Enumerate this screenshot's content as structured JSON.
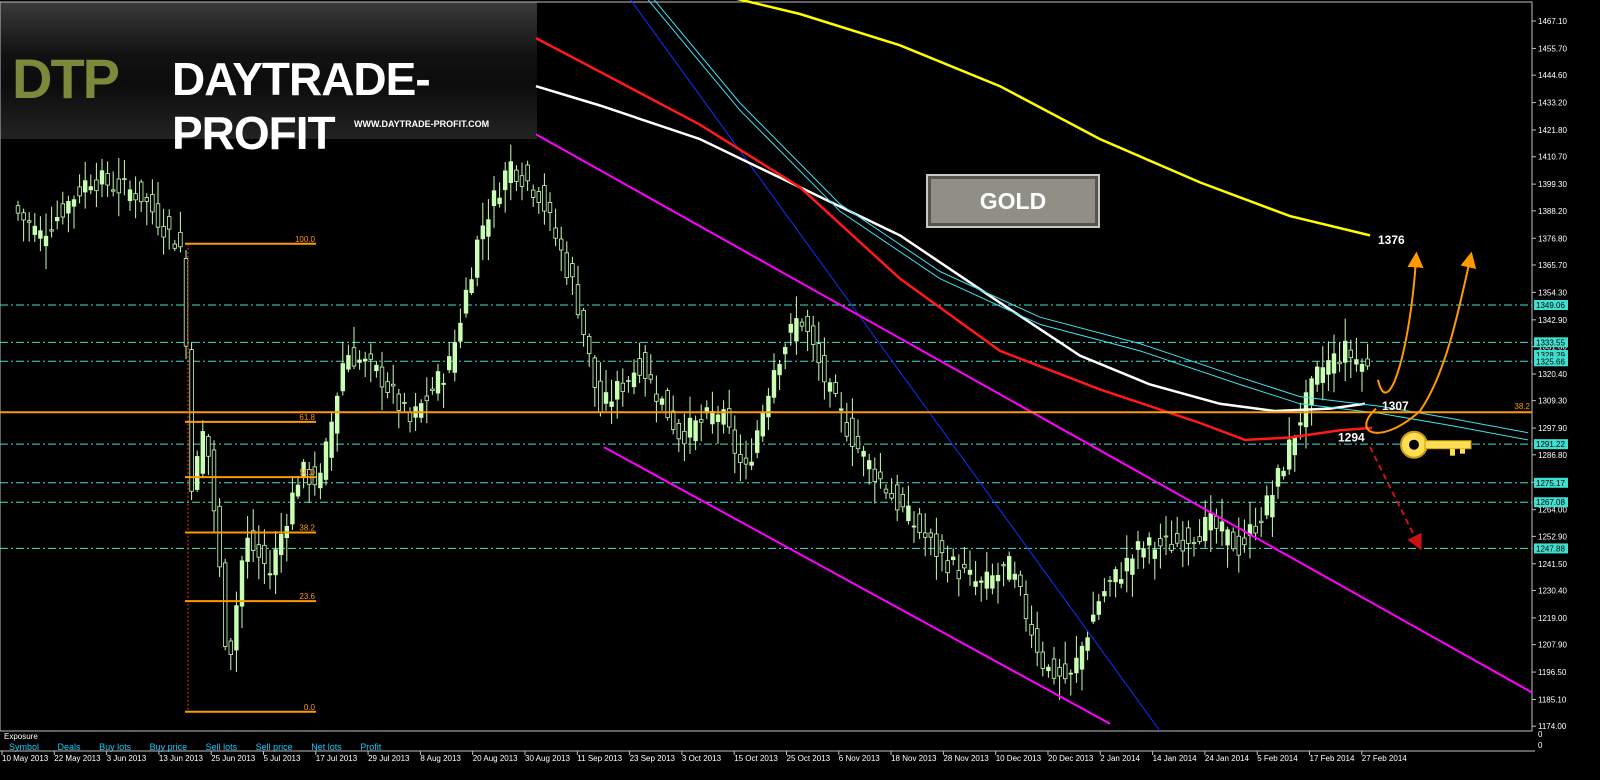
{
  "logo": {
    "mark": "DTP",
    "name": "DAYTRADE-PROFIT",
    "url": "WWW.DAYTRADE-PROFIT.COM"
  },
  "instrument_label": "GOLD",
  "exposure": {
    "title": "Exposure",
    "columns": [
      "Symbol",
      "Deals",
      "Buy lots",
      "Buy price",
      "Sell lots",
      "Sell price",
      "Net lots",
      "Profit"
    ]
  },
  "chart_data": {
    "type": "candlestick",
    "x_labels": [
      "10 May 2013",
      "22 May 2013",
      "3 Jun 2013",
      "13 Jun 2013",
      "25 Jun 2013",
      "5 Jul 2013",
      "17 Jul 2013",
      "29 Jul 2013",
      "8 Aug 2013",
      "20 Aug 2013",
      "30 Aug 2013",
      "11 Sep 2013",
      "23 Sep 2013",
      "3 Oct 2013",
      "15 Oct 2013",
      "25 Oct 2013",
      "6 Nov 2013",
      "18 Nov 2013",
      "28 Nov 2013",
      "10 Dec 2013",
      "20 Dec 2013",
      "2 Jan 2014",
      "14 Jan 2014",
      "24 Jan 2014",
      "5 Feb 2014",
      "17 Feb 2014",
      "27 Feb 2014"
    ],
    "y_ticks": [
      "1467.10",
      "1455.70",
      "1444.60",
      "1433.20",
      "1421.80",
      "1410.70",
      "1399.30",
      "1388.20",
      "1376.80",
      "1365.70",
      "1354.30",
      "1342.90",
      "1331.80",
      "1320.40",
      "1309.30",
      "1297.90",
      "1286.80",
      "1275.40",
      "1264.00",
      "1252.90",
      "1241.50",
      "1230.40",
      "1219.00",
      "1207.90",
      "1196.50",
      "1185.10",
      "1174.00"
    ],
    "y_range": [
      1172,
      1475
    ],
    "price_tags": [
      {
        "label": "1349.06",
        "value": 1349.06
      },
      {
        "label": "1333.55",
        "value": 1333.55
      },
      {
        "label": "1328.29",
        "value": 1328.29
      },
      {
        "label": "1325.66",
        "value": 1325.66
      },
      {
        "label": "1291.22",
        "value": 1291.22
      },
      {
        "label": "1275.17",
        "value": 1275.17
      },
      {
        "label": "1267.08",
        "value": 1267.08
      },
      {
        "label": "1247.88",
        "value": 1247.88
      }
    ],
    "horizontal_levels": [
      1349.06,
      1333.55,
      1325.66,
      1291.22,
      1275.17,
      1267.08,
      1247.88
    ],
    "key_level": {
      "value": 1304.5,
      "label": "38.2"
    },
    "fibonacci": [
      {
        "label": "100.0",
        "value": 1374.5
      },
      {
        "label": "61.8",
        "value": 1300.5
      },
      {
        "label": "50.0",
        "value": 1277.5
      },
      {
        "label": "38.2",
        "value": 1254.5
      },
      {
        "label": "23.6",
        "value": 1226.0
      },
      {
        "label": "0.0",
        "value": 1180.0
      }
    ],
    "annotations": [
      {
        "label": "1376",
        "value": 1376
      },
      {
        "label": "1307",
        "value": 1307
      },
      {
        "label": "1294",
        "value": 1294
      }
    ],
    "series": [
      {
        "name": "",
        "color": "#ffff00"
      },
      {
        "name": "",
        "color": "#ffffff"
      },
      {
        "name": "",
        "color": "#ff1a1a"
      },
      {
        "name": "",
        "color": "#40e0f0"
      },
      {
        "name": "",
        "color": "#ff00ff"
      },
      {
        "name": "",
        "color": "#1030ff"
      }
    ],
    "candle_color": "#c8ffb4",
    "grid": false
  }
}
